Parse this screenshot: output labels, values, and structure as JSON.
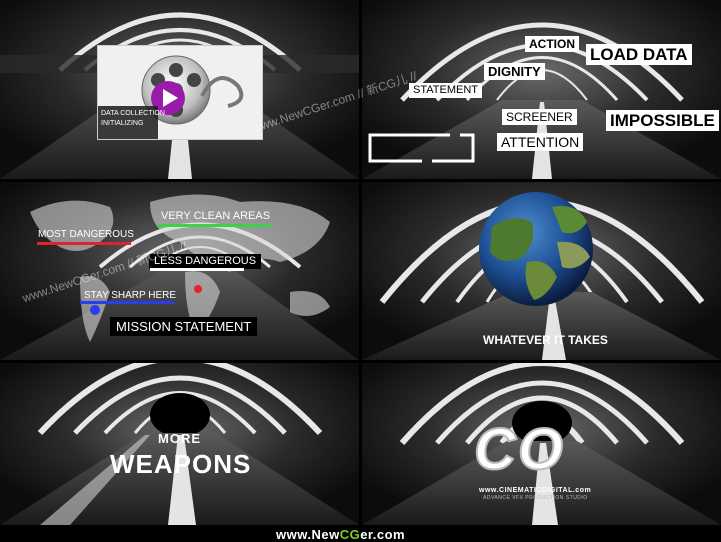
{
  "frames": {
    "f1": {
      "card_line1": "DATA COLLECTION",
      "card_line2": "INITIALIZING"
    },
    "f2": {
      "words": {
        "action": "ACTION",
        "load_data": "LOAD DATA",
        "dignity": "DIGNITY",
        "statement": "STATEMENT",
        "screener": "SCREENER",
        "impossible": "IMPOSSIBLE",
        "attention": "ATTENTION"
      }
    },
    "f3": {
      "labels": {
        "most_dangerous": "MOST DANGEROUS",
        "very_clean_areas": "VERY CLEAN AREAS",
        "less_dangerous": "LESS DANGEROUS",
        "stay_sharp_here": "STAY SHARP HERE",
        "mission_statement": "MISSION STATEMENT"
      },
      "colors": {
        "red": "#e0242e",
        "green": "#3bd14b",
        "blue": "#2b3bf0"
      }
    },
    "f4": {
      "caption": "WHATEVER IT TAKES"
    },
    "f5": {
      "line1": "MORE",
      "line2": "WEAPONS"
    },
    "f6": {
      "logo": "CO",
      "url": "www.CINEMATICDIGITAL.com",
      "tagline": "ADVANCE VFX PRODUCTION STUDIO"
    }
  },
  "watermark": "www.NewCGer.com // 新CG儿 //",
  "footer": {
    "prefix": "www.",
    "mid1": "New",
    "mid2": "CG",
    "suffix": "er.com"
  },
  "colors": {
    "footer_green": "#7cd21c"
  }
}
